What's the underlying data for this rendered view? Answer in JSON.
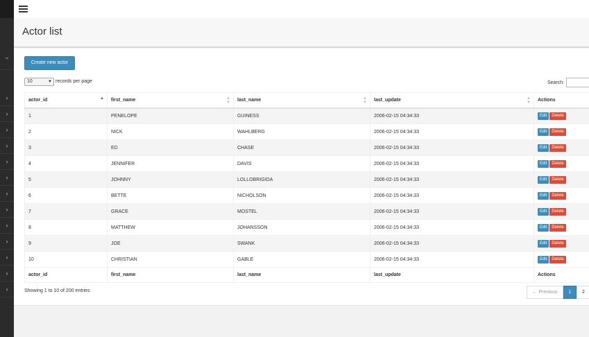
{
  "page": {
    "title": "Actor list"
  },
  "toolbar": {
    "create_label": "Create new actor"
  },
  "length": {
    "value": "10",
    "label": "records per page"
  },
  "search": {
    "label": "Search:",
    "value": ""
  },
  "table": {
    "columns": [
      "actor_id",
      "first_name",
      "last_name",
      "last_update",
      "Actions"
    ],
    "rows": [
      [
        "1",
        "PENELOPE",
        "GUINESS",
        "2006-02-15 04:34:33"
      ],
      [
        "2",
        "NICK",
        "WAHLBERG",
        "2006-02-15 04:34:33"
      ],
      [
        "3",
        "ED",
        "CHASE",
        "2006-02-15 04:34:33"
      ],
      [
        "4",
        "JENNIFER",
        "DAVIS",
        "2006-02-15 04:34:33"
      ],
      [
        "5",
        "JOHNNY",
        "LOLLOBRIGIDA",
        "2006-02-15 04:34:33"
      ],
      [
        "6",
        "BETTE",
        "NICHOLSON",
        "2006-02-15 04:34:33"
      ],
      [
        "7",
        "GRACE",
        "MOSTEL",
        "2006-02-15 04:34:33"
      ],
      [
        "8",
        "MATTHEW",
        "JOHANSSON",
        "2006-02-15 04:34:33"
      ],
      [
        "9",
        "JOE",
        "SWANK",
        "2006-02-15 04:34:33"
      ],
      [
        "10",
        "CHRISTIAN",
        "GABLE",
        "2006-02-15 04:34:33"
      ]
    ],
    "edit_label": "Edit",
    "delete_label": "Delete"
  },
  "info": "Showing 1 to 10 of 200 entries",
  "pager": {
    "previous": "← Previous",
    "pages": [
      "1",
      "2"
    ]
  },
  "icons": {
    "menu": "hamburger-icon",
    "sidebar": "chevron-right-icon",
    "sort": "sort-icon"
  },
  "colors": {
    "primary": "#3c8dbc",
    "danger": "#dd4b39",
    "sidebar": "#2b2b2b"
  }
}
